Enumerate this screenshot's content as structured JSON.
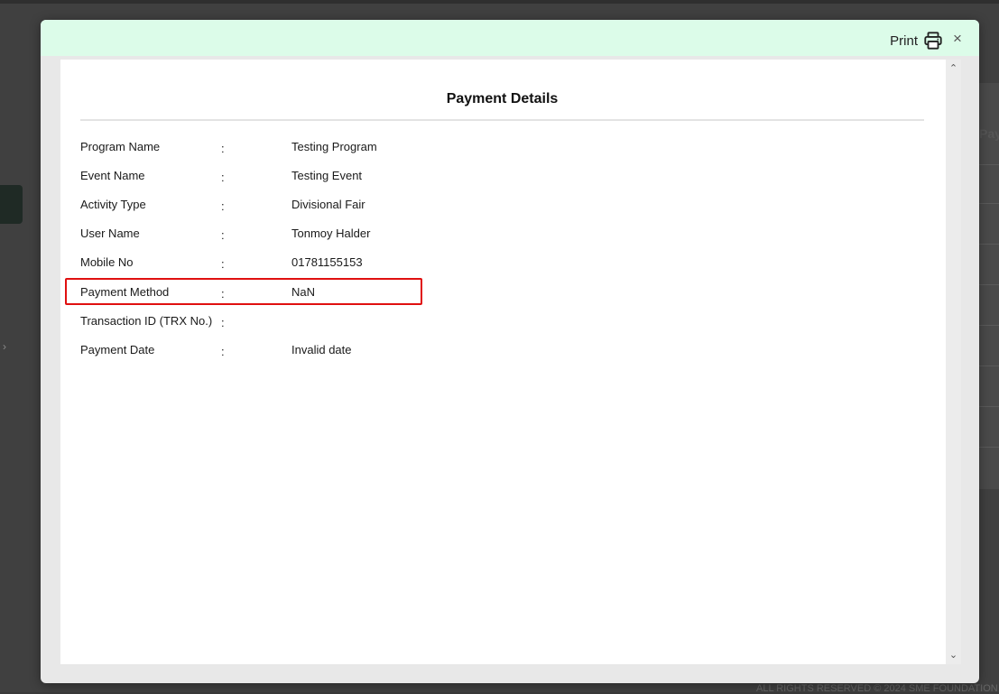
{
  "modal": {
    "print_label": "Print",
    "print_icon": "printer-icon",
    "close_icon": "close-icon",
    "close_glyph": "×",
    "header_color": "#dcfce9",
    "scroll_up_glyph": "⌃",
    "scroll_down_glyph": "⌄"
  },
  "payment_details": {
    "title": "Payment Details",
    "separator": ":",
    "fields": [
      {
        "label": "Program Name",
        "value": "Testing Program"
      },
      {
        "label": "Event Name",
        "value": "Testing Event"
      },
      {
        "label": "Activity Type",
        "value": "Divisional Fair"
      },
      {
        "label": "User Name",
        "value": "Tonmoy Halder"
      },
      {
        "label": "Mobile No",
        "value": "01781155153"
      },
      {
        "label": "Payment Method",
        "value": "NaN"
      },
      {
        "label": "Transaction ID (TRX No.)",
        "value": ""
      },
      {
        "label": "Payment Date",
        "value": "Invalid date"
      }
    ],
    "highlight_color": "#e01010",
    "highlighted_field": "Payment Method"
  },
  "background": {
    "table_header_fragment": "Pay",
    "footer_fragment": "ALL RIGHTS RESERVED © 2024 SME FOUNDATION"
  }
}
